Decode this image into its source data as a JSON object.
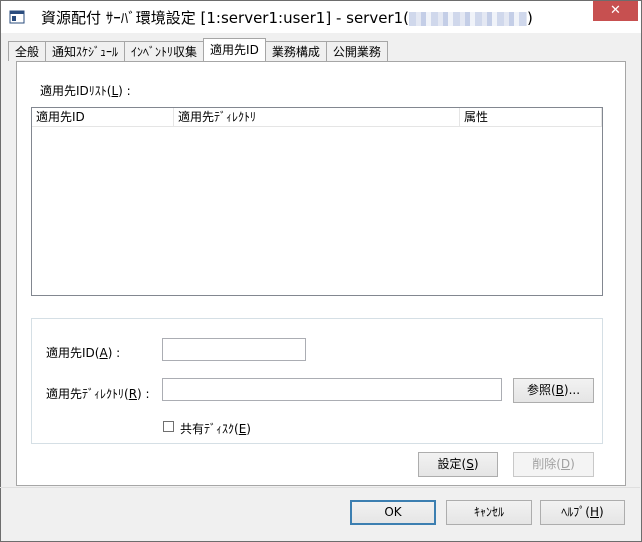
{
  "window": {
    "title_prefix": "資源配付 ｻｰﾊﾞ環境設定 [1:server1:user1]  - server1(",
    "title_suffix": ")",
    "close_glyph": "✕"
  },
  "tabs": [
    {
      "label": "全般"
    },
    {
      "label": "通知ｽｹｼﾞｭｰﾙ"
    },
    {
      "label": "ｲﾝﾍﾞﾝﾄﾘ収集"
    },
    {
      "label": "適用先ID"
    },
    {
      "label": "業務構成"
    },
    {
      "label": "公開業務"
    }
  ],
  "list_label_prefix": "適用先IDﾘｽﾄ(",
  "list_label_key": "L",
  "list_label_suffix": ")  :",
  "list_columns": [
    "適用先ID",
    "適用先ﾃﾞｨﾚｸﾄﾘ",
    "属性"
  ],
  "fields": {
    "id_label_prefix": "適用先ID(",
    "id_label_key": "A",
    "id_label_suffix": ")  :",
    "id_value": "",
    "dir_label_prefix": "適用先ﾃﾞｨﾚｸﾄﾘ(",
    "dir_label_key": "R",
    "dir_label_suffix": ")  :",
    "dir_value": "",
    "browse_prefix": "参照(",
    "browse_key": "B",
    "browse_suffix": ")...",
    "shared_prefix": "共有ﾃﾞｨｽｸ(",
    "shared_key": "E",
    "shared_suffix": ")"
  },
  "actions": {
    "set_prefix": "設定(",
    "set_key": "S",
    "set_suffix": ")",
    "delete_prefix": "削除(",
    "delete_key": "D",
    "delete_suffix": ")"
  },
  "footer": {
    "ok": "OK",
    "cancel": "ｷｬﾝｾﾙ",
    "help_prefix": "ﾍﾙﾌﾟ(",
    "help_key": "H",
    "help_suffix": ")"
  }
}
